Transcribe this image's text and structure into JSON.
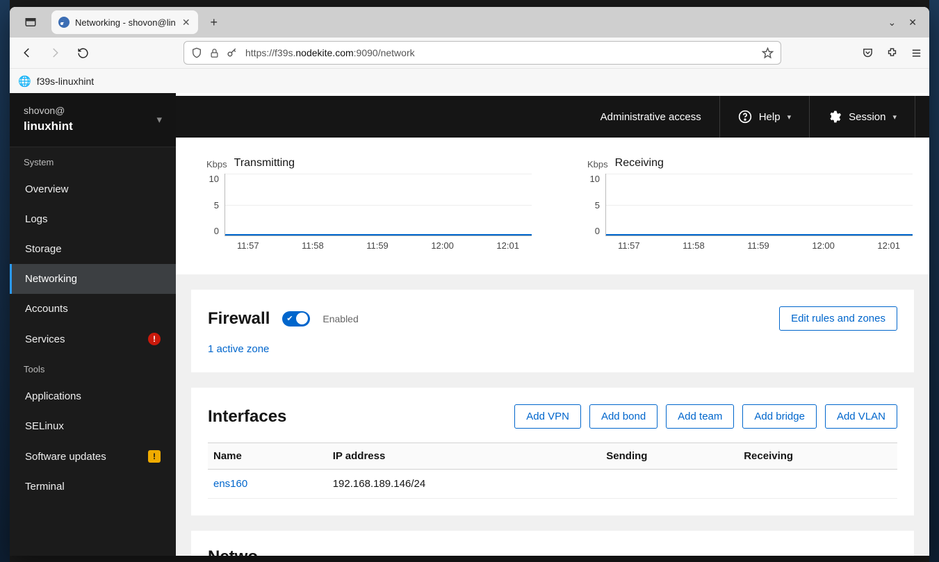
{
  "browser": {
    "tab_title": "Networking - shovon@lin",
    "url_prefix": "https://f39s.",
    "url_domain": "nodekite.com",
    "url_suffix": ":9090/network",
    "bookmark": "f39s-linuxhint"
  },
  "sidebar": {
    "user_at": "shovon@",
    "user_host": "linuxhint",
    "section_system": "System",
    "section_tools": "Tools",
    "items_system": [
      {
        "label": "Overview"
      },
      {
        "label": "Logs"
      },
      {
        "label": "Storage"
      },
      {
        "label": "Networking",
        "active": true
      },
      {
        "label": "Accounts"
      },
      {
        "label": "Services",
        "badge": "err"
      }
    ],
    "items_tools": [
      {
        "label": "Applications"
      },
      {
        "label": "SELinux"
      },
      {
        "label": "Software updates",
        "badge": "warn"
      },
      {
        "label": "Terminal"
      }
    ]
  },
  "topbar": {
    "admin": "Administrative access",
    "help": "Help",
    "session": "Session"
  },
  "chart_data": [
    {
      "type": "line",
      "title": "Transmitting",
      "unit": "Kbps",
      "yticks": [
        10,
        5,
        0
      ],
      "ylim": [
        0,
        10
      ],
      "x": [
        "11:57",
        "11:58",
        "11:59",
        "12:00",
        "12:01"
      ],
      "values": [
        0,
        0,
        0,
        0,
        0
      ]
    },
    {
      "type": "line",
      "title": "Receiving",
      "unit": "Kbps",
      "yticks": [
        10,
        5,
        0
      ],
      "ylim": [
        0,
        10
      ],
      "x": [
        "11:57",
        "11:58",
        "11:59",
        "12:00",
        "12:01"
      ],
      "values": [
        0,
        0,
        0,
        0,
        0
      ]
    }
  ],
  "firewall": {
    "title": "Firewall",
    "status": "Enabled",
    "edit_btn": "Edit rules and zones",
    "active_zone": "1 active zone"
  },
  "interfaces": {
    "title": "Interfaces",
    "buttons": [
      "Add VPN",
      "Add bond",
      "Add team",
      "Add bridge",
      "Add VLAN"
    ],
    "columns": [
      "Name",
      "IP address",
      "Sending",
      "Receiving"
    ],
    "rows": [
      {
        "name": "ens160",
        "ip": "192.168.189.146/24",
        "sending": "",
        "receiving": ""
      }
    ]
  },
  "next_card_title_partial": "Netwo"
}
